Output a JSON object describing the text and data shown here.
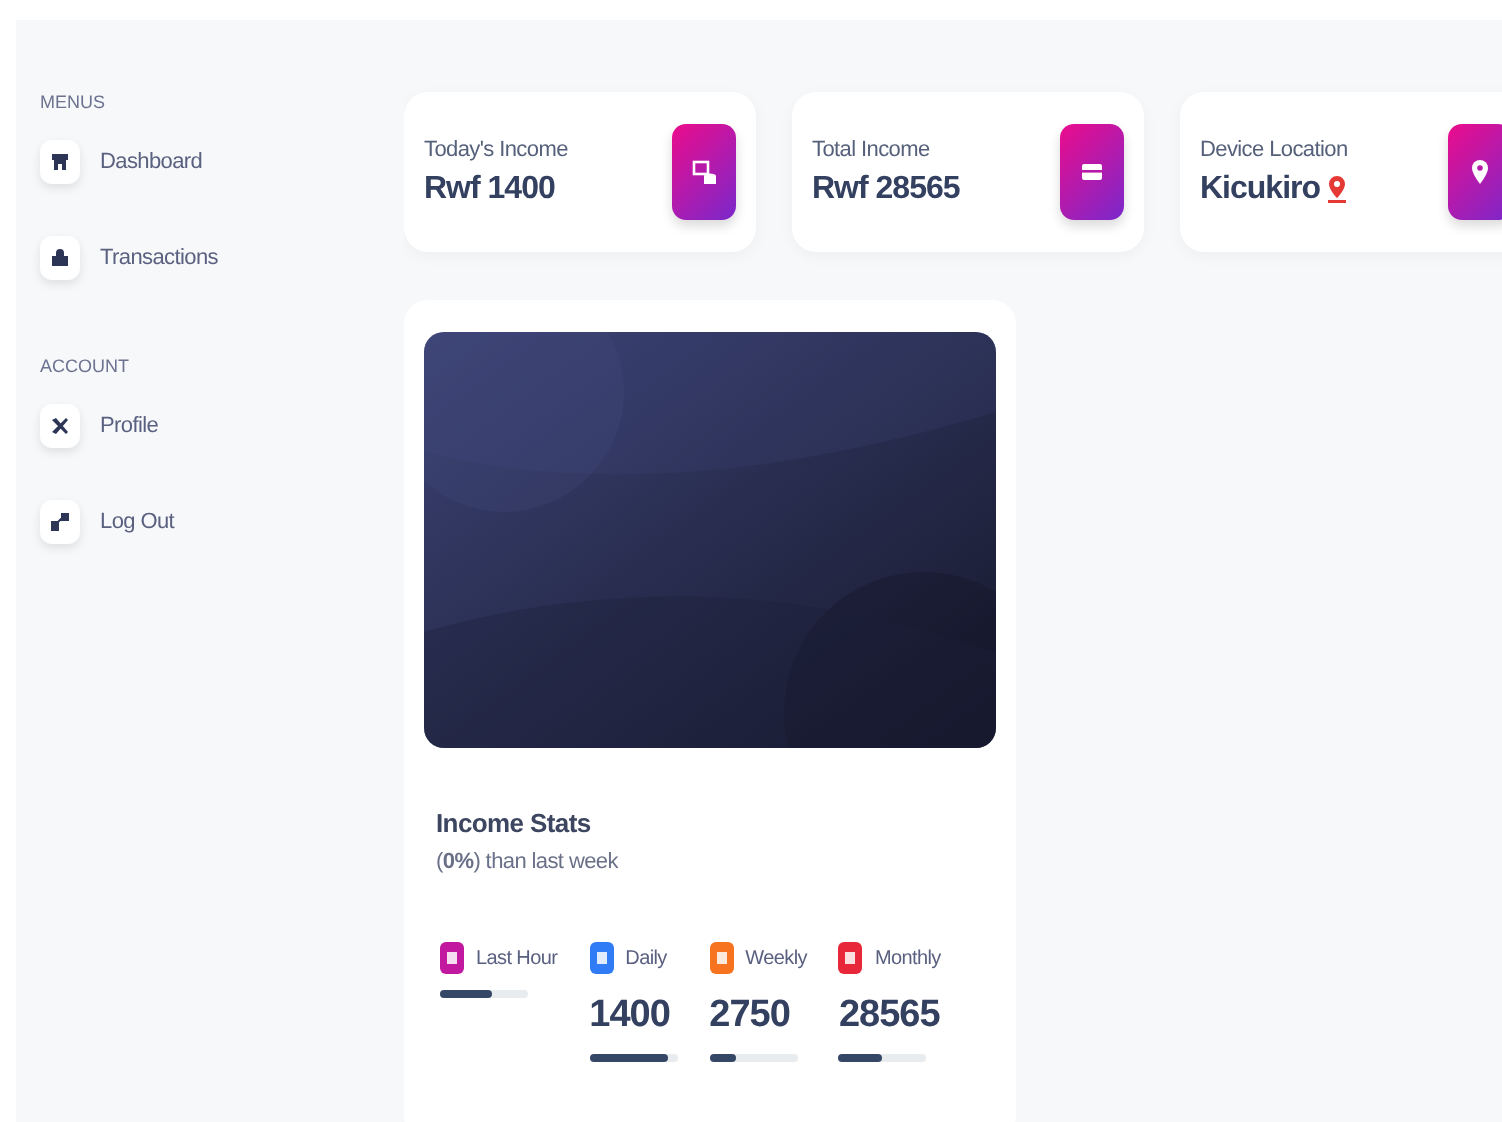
{
  "sidebar": {
    "sections": [
      {
        "heading": "MENUS",
        "items": [
          {
            "label": "Dashboard"
          },
          {
            "label": "Transactions"
          }
        ]
      },
      {
        "heading": "ACCOUNT",
        "items": [
          {
            "label": "Profile"
          },
          {
            "label": "Log Out"
          }
        ]
      }
    ]
  },
  "stat_cards": [
    {
      "title": "Today's Income",
      "value": "Rwf 1400"
    },
    {
      "title": "Total Income",
      "value": "Rwf 28565"
    },
    {
      "title": "Device Location",
      "value": "Kicukiro"
    }
  ],
  "income_card": {
    "title": "Income Stats",
    "subtitle": "(**0%**) than last week",
    "stats": [
      {
        "label": "Last Hour",
        "color": "#c2189f",
        "level": 0.6
      },
      {
        "label": "Daily",
        "value": "1400",
        "color": "#2f7cf6",
        "level": 0.9
      },
      {
        "label": "Weekly",
        "value": "2750",
        "color": "#f7731f",
        "level": 0.3
      },
      {
        "label": "Monthly",
        "value": "28565",
        "color": "#e8283a",
        "level": 0.5
      }
    ]
  }
}
